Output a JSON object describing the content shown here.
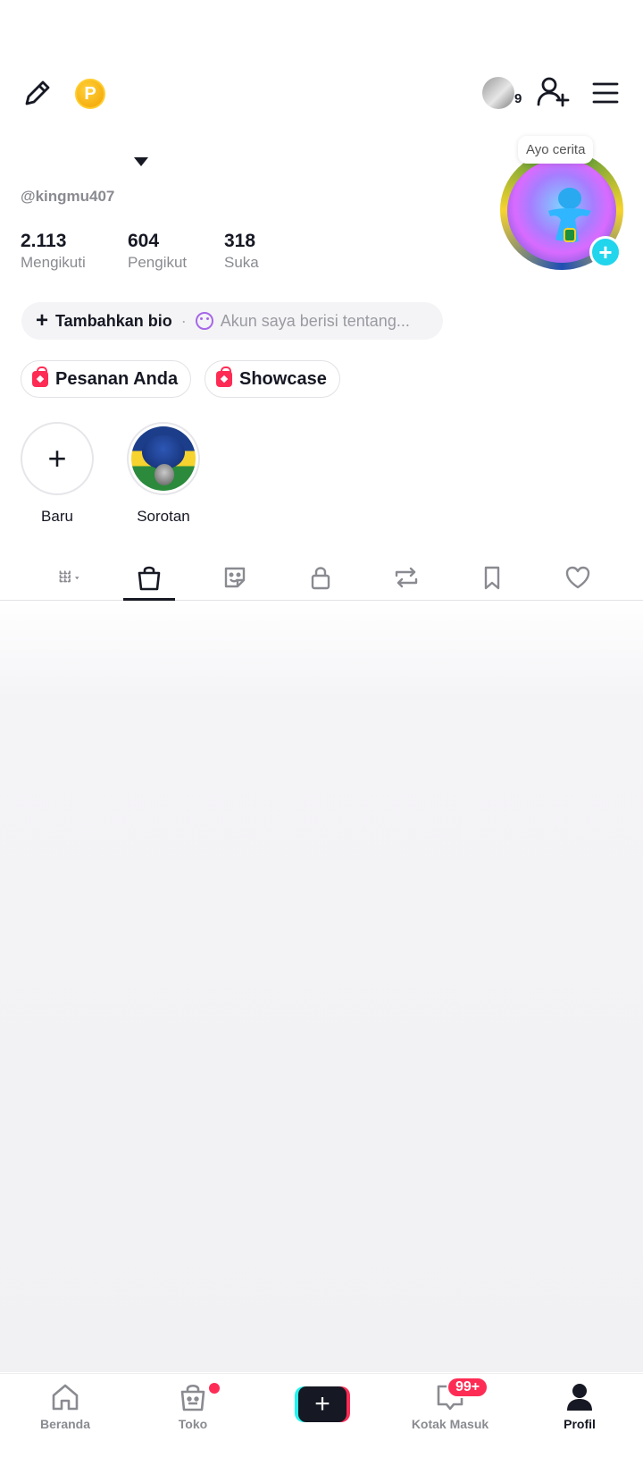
{
  "topbar": {
    "coin_letter": "P",
    "friends_count": "9",
    "icons": [
      "pencil-icon",
      "coin-icon",
      "add-user-icon",
      "menu-icon"
    ]
  },
  "profile": {
    "username": "@kingmu407",
    "stats": [
      {
        "value": "2.113",
        "label": "Mengikuti"
      },
      {
        "value": "604",
        "label": "Pengikut"
      },
      {
        "value": "318",
        "label": "Suka"
      }
    ],
    "story_tip": "Ayo cerita",
    "avatar_plus": "+"
  },
  "bio": {
    "plus": "+",
    "add_label": "Tambahkan bio",
    "separator": "·",
    "hint": "Akun saya berisi tentang..."
  },
  "chips": [
    {
      "label": "Pesanan Anda"
    },
    {
      "label": "Showcase"
    }
  ],
  "highlights": [
    {
      "label": "Baru",
      "plus": "+"
    },
    {
      "label": "Sorotan"
    }
  ],
  "tabs": [
    {
      "icon": "grid-filter-icon"
    },
    {
      "icon": "shopping-bag-icon",
      "active": true
    },
    {
      "icon": "sticker-icon"
    },
    {
      "icon": "lock-icon"
    },
    {
      "icon": "repost-icon"
    },
    {
      "icon": "bookmark-icon"
    },
    {
      "icon": "heart-icon"
    }
  ],
  "bottom_nav": {
    "items": [
      {
        "label": "Beranda",
        "icon": "home-icon"
      },
      {
        "label": "Toko",
        "icon": "shop-bag-icon"
      },
      {
        "label": "",
        "icon": "create-plus-icon"
      },
      {
        "label": "Kotak Masuk",
        "icon": "inbox-icon",
        "badge": "99+"
      },
      {
        "label": "Profil",
        "icon": "profile-icon",
        "active": true
      }
    ],
    "create_plus": "+"
  },
  "colors": {
    "accent_pink": "#fe2c55",
    "accent_cyan": "#25f4ee",
    "text_primary": "#161823",
    "text_secondary": "#8a8b91"
  }
}
